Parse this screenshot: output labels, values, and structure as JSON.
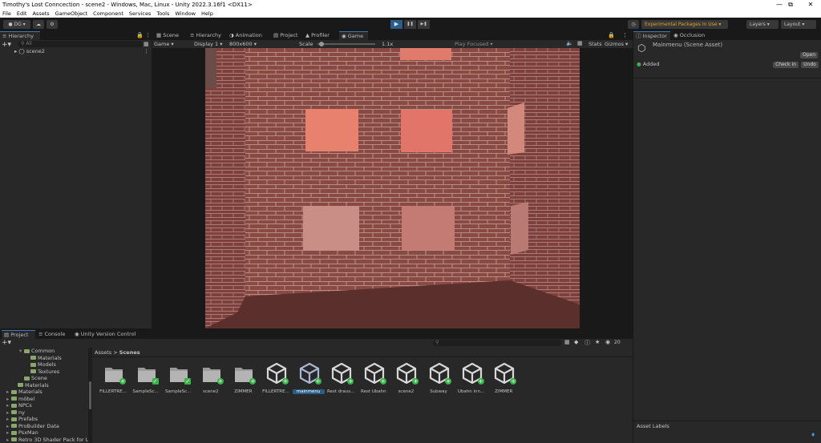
{
  "window": {
    "title": "Timothy's Lost Conncection - scene2 - Windows, Mac, Linux - Unity 2022.3.16f1 <DX11>",
    "minimize": "—",
    "maximize": "⧉",
    "close": "✕"
  },
  "menu": [
    "File",
    "Edit",
    "Assets",
    "GameObject",
    "Component",
    "Services",
    "Tools",
    "Window",
    "Help"
  ],
  "toolbar": {
    "account": "DG",
    "play": "▶",
    "pause": "❚❚",
    "step": "▶❚",
    "experimental": "Experimental Packages In Use",
    "layers": "Layers",
    "layout": "Layout"
  },
  "hierarchy": {
    "tab": "Hierarchy",
    "search_placeholder": "All",
    "scene": "scene2"
  },
  "center_tabs": [
    "Scene",
    "Hierarchy",
    "Animation",
    "Project",
    "Profiler",
    "Game"
  ],
  "game_toolbar": {
    "mode": "Game",
    "display": "Display 1",
    "resolution": "800x600",
    "scale_label": "Scale",
    "scale_value": "1.1x",
    "play_mode": "Play Focused",
    "stats": "Stats",
    "gizmos": "Gizmos"
  },
  "inspector": {
    "tabs": [
      "Inspector",
      "Occlusion"
    ],
    "asset_name": "Mainmenu (Scene Asset)",
    "open_button": "Open",
    "status": "Added",
    "checkin_button": "Check in",
    "undo_button": "Undo"
  },
  "bottom_tabs": [
    "Project",
    "Console",
    "Unity Version Control"
  ],
  "project": {
    "tree": [
      {
        "label": "Common",
        "indent": 1
      },
      {
        "label": "Materials",
        "indent": 2
      },
      {
        "label": "Models",
        "indent": 2
      },
      {
        "label": "Textures",
        "indent": 2
      },
      {
        "label": "Scene",
        "indent": 1
      },
      {
        "label": "Materials",
        "indent": 0
      },
      {
        "label": "Materials",
        "indent": -1
      },
      {
        "label": "möbel",
        "indent": -1
      },
      {
        "label": "NPCs",
        "indent": -1
      },
      {
        "label": "ny",
        "indent": -1
      },
      {
        "label": "Prefabs",
        "indent": -1
      },
      {
        "label": "ProBuilder Data",
        "indent": -1
      },
      {
        "label": "PsxMan",
        "indent": -1
      },
      {
        "label": "Retro 3D Shader Pack for U",
        "indent": -1
      }
    ],
    "breadcrumb_root": "Assets",
    "breadcrumb_sep": ">",
    "breadcrumb_current": "Scenes",
    "slider_count": "20",
    "assets": [
      {
        "label": "FILLERTRE...",
        "kind": "folder",
        "badge": "add"
      },
      {
        "label": "SampleSc...",
        "kind": "folder",
        "badge": "check"
      },
      {
        "label": "SampleSc...",
        "kind": "folder",
        "badge": "check"
      },
      {
        "label": "scene2",
        "kind": "folder",
        "badge": "add"
      },
      {
        "label": "ZIMMER",
        "kind": "folder",
        "badge": "add"
      },
      {
        "label": "FILLERTRE...",
        "kind": "unity",
        "badge": "add"
      },
      {
        "label": "mainmenu",
        "kind": "unity",
        "badge": "add",
        "selected": true
      },
      {
        "label": "Rest draus...",
        "kind": "unity",
        "badge": "add"
      },
      {
        "label": "Rest Ubahn",
        "kind": "unity",
        "badge": "add"
      },
      {
        "label": "scene2",
        "kind": "unity",
        "badge": "add"
      },
      {
        "label": "Subway",
        "kind": "unity",
        "badge": "add"
      },
      {
        "label": "Ubahn inn...",
        "kind": "unity",
        "badge": "add"
      },
      {
        "label": "ZIMMER",
        "kind": "unity",
        "badge": "add"
      }
    ],
    "asset_labels": "Asset Labels"
  },
  "colors": {
    "accent": "#3a79bb",
    "experimental": "#e0a030",
    "badge_green": "#3bb34a",
    "brick": "#8a4a44"
  }
}
